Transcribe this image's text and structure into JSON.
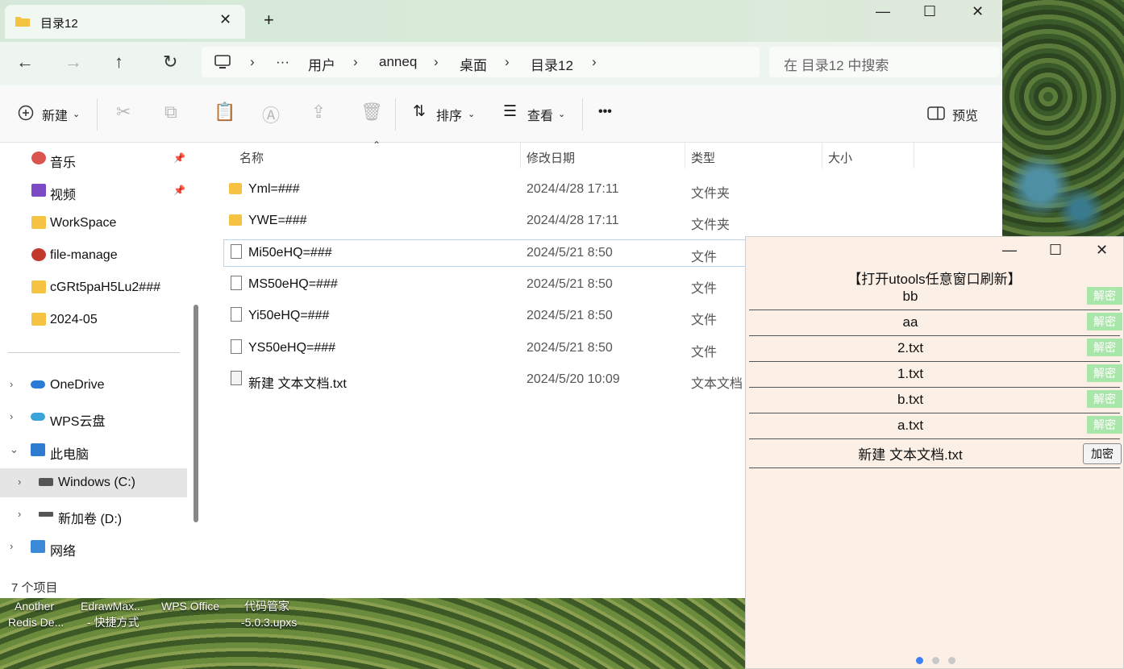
{
  "window": {
    "tab_title": "目录12",
    "tab_close": "✕",
    "new_tab": "+",
    "minimize": "—",
    "maximize": "☐",
    "close": "✕"
  },
  "address": {
    "crumbs": [
      "用户",
      "anneq",
      "桌面",
      "目录12"
    ],
    "more": "···",
    "separator": "›",
    "search_placeholder": "在 目录12 中搜索"
  },
  "nav_icons": [
    "back-arrow-icon",
    "forward-arrow-icon",
    "up-arrow-icon",
    "refresh-icon"
  ],
  "toolbar": {
    "new_label": "新建",
    "sort_label": "排序",
    "view_label": "查看",
    "more_label": "•••",
    "preview_label": "预览"
  },
  "sidebar": {
    "items": [
      {
        "label": "音乐",
        "icon": "music-icon",
        "pinned": true
      },
      {
        "label": "视频",
        "icon": "video-icon",
        "pinned": true
      },
      {
        "label": "WorkSpace",
        "icon": "folder-icon"
      },
      {
        "label": "file-manage",
        "icon": "app-icon"
      },
      {
        "label": "cGRt5paH5Lu2###",
        "icon": "folder-icon"
      },
      {
        "label": "2024-05",
        "icon": "folder-icon"
      },
      {
        "label": "OneDrive",
        "icon": "cloud-icon"
      },
      {
        "label": "WPS云盘",
        "icon": "wps-cloud-icon"
      },
      {
        "label": "此电脑",
        "icon": "computer-icon"
      },
      {
        "label": "Windows  (C:)",
        "icon": "drive-c-icon"
      },
      {
        "label": "新加卷 (D:)",
        "icon": "drive-d-icon"
      },
      {
        "label": "网络",
        "icon": "network-icon"
      }
    ]
  },
  "columns": {
    "name": "名称",
    "date": "修改日期",
    "type": "类型",
    "size": "大小"
  },
  "files": [
    {
      "name": "Yml=###",
      "date": "2024/4/28 17:11",
      "type": "文件夹",
      "kind": "folder"
    },
    {
      "name": "YWE=###",
      "date": "2024/4/28 17:11",
      "type": "文件夹",
      "kind": "folder"
    },
    {
      "name": "Mi50eHQ=###",
      "date": "2024/5/21 8:50",
      "type": "文件",
      "kind": "file"
    },
    {
      "name": "MS50eHQ=###",
      "date": "2024/5/21 8:50",
      "type": "文件",
      "kind": "file"
    },
    {
      "name": "Yi50eHQ=###",
      "date": "2024/5/21 8:50",
      "type": "文件",
      "kind": "file"
    },
    {
      "name": "YS50eHQ=###",
      "date": "2024/5/21 8:50",
      "type": "文件",
      "kind": "file"
    },
    {
      "name": "新建 文本文档.txt",
      "date": "2024/5/20 10:09",
      "type": "文本文档",
      "kind": "text"
    }
  ],
  "status": "7 个项目",
  "desktop_icons": [
    {
      "line1": "Another",
      "line2": "Redis De..."
    },
    {
      "line1": "EdrawMax...",
      "line2": "- 快捷方式"
    },
    {
      "line1": "WPS Office",
      "line2": ""
    },
    {
      "line1": "代码管家",
      "line2": "-5.0.3.upxs"
    }
  ],
  "popup": {
    "title": "【打开utools任意窗口刷新】",
    "minimize": "—",
    "maximize": "☐",
    "close": "✕",
    "rows": [
      {
        "name": "bb",
        "action": "解密"
      },
      {
        "name": "aa",
        "action": "解密"
      },
      {
        "name": "2.txt",
        "action": "解密"
      },
      {
        "name": "1.txt",
        "action": "解密"
      },
      {
        "name": "b.txt",
        "action": "解密"
      },
      {
        "name": "a.txt",
        "action": "解密"
      },
      {
        "name": "新建 文本文档.txt",
        "action": "加密"
      }
    ],
    "page_dots": 3,
    "active_dot": 1
  },
  "colors": {
    "decrypt_button": "#a9e6a9",
    "popup_bg": "#fcefe6",
    "folder": "#f5c242"
  }
}
